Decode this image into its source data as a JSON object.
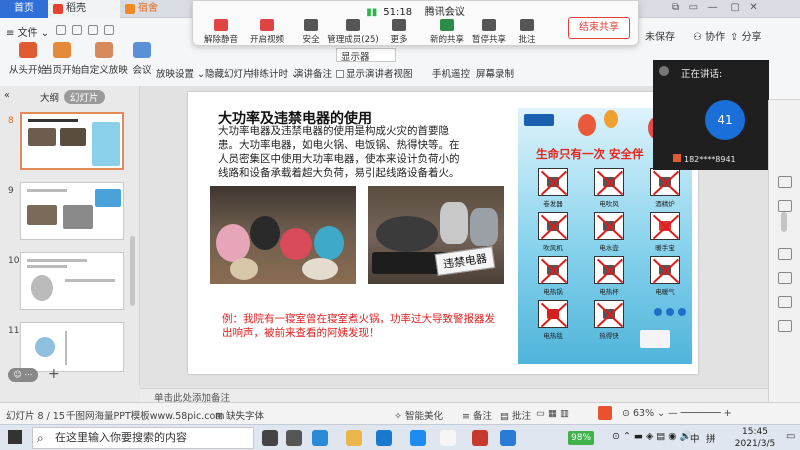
{
  "tabs": {
    "home": "首页",
    "daoke": "稻壳",
    "dorm": "宿舍",
    "collab": "协作",
    "share": "分享"
  },
  "menu": {
    "file": "文件"
  },
  "ribbon": {
    "buttons": [
      "从头开始",
      "当页开始",
      "自定义放映",
      "会议"
    ],
    "small": [
      "放映设置",
      "隐藏幻灯片",
      "排练计时",
      "演讲备注",
      "显示演讲者视图",
      "手机遥控",
      "屏幕录制"
    ],
    "dropdown": "显示器",
    "unsaved": "未保存"
  },
  "meeting": {
    "time": "51:18",
    "title": "腾讯会议",
    "buttons": [
      "解除静音",
      "开启视频",
      "安全",
      "管理成员(25)",
      "更多",
      "新的共享",
      "暂停共享",
      "批注"
    ],
    "end_share": "结束共享"
  },
  "left_pane": {
    "tabs": [
      "大纲",
      "幻灯片"
    ],
    "slide_numbers": [
      "8",
      "9",
      "10",
      "11"
    ]
  },
  "slide": {
    "title": "大功率及违禁电器的使用",
    "body": "大功率电器及违禁电器的使用是构成火灾的首要隐患。大功率电器，如电火锅、电饭锅、热得快等。在人员密集区中使用大功率电器，使本来设计负荷小的线路和设备承载着超大负荷，易引起线路设备着火。",
    "photo_tag": "违禁电器",
    "caption": "例：我院有一寝室曾在寝室煮火锅，功率过大导致警报器发出响声，被前来查看的阿姨发现！",
    "poster": {
      "heading": "生命只有一次  安全伴",
      "items": [
        "卷发器",
        "电吹风",
        "酒精炉",
        "吹风机",
        "电水壶",
        "暖手宝",
        "电热锅",
        "电热杯",
        "电暖气",
        "电热毯",
        "热得快"
      ]
    }
  },
  "video_panel": {
    "speaking_label": "正在讲话:",
    "avatar_number": "41",
    "participant": "182****8941"
  },
  "notes_placeholder": "单击此处添加备注",
  "status": {
    "slide_pos": "幻灯片 8 / 15",
    "template": "千图网海量PPT模板www.58pic.com",
    "missing_font": "缺失字体",
    "beautify": "智能美化",
    "notes": "备注",
    "comments": "批注",
    "zoom": "63%"
  },
  "taskbar": {
    "search_placeholder": "在这里输入你要搜索的内容",
    "battery": "98%",
    "lang1": "中",
    "lang2": "拼",
    "time": "15:45",
    "date": "2021/3/5"
  },
  "colors": {
    "accent": "#2f6fd6",
    "end_share": "#e0413a",
    "caption": "#e02020",
    "avatar": "#1a6fd8",
    "poster_head": "#e8261c"
  }
}
